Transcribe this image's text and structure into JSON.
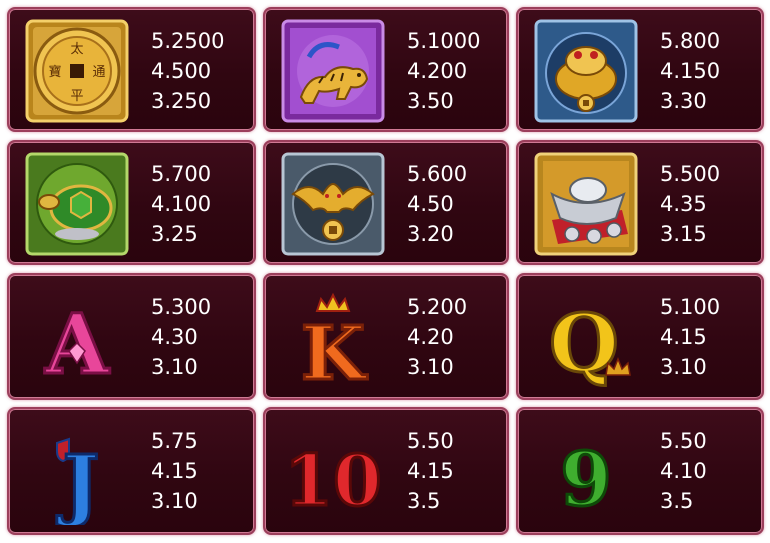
{
  "paytable": [
    {
      "symbol": "gold-coin",
      "pays": [
        "5.2500",
        "4.500",
        "3.250"
      ]
    },
    {
      "symbol": "tiger",
      "pays": [
        "5.1000",
        "4.200",
        "3.50"
      ]
    },
    {
      "symbol": "golden-toad",
      "pays": [
        "5.800",
        "4.150",
        "3.30"
      ]
    },
    {
      "symbol": "turtle",
      "pays": [
        "5.700",
        "4.100",
        "3.25"
      ]
    },
    {
      "symbol": "bat-coin",
      "pays": [
        "5.600",
        "4.50",
        "3.20"
      ]
    },
    {
      "symbol": "silver-ingot",
      "pays": [
        "5.500",
        "4.35",
        "3.15"
      ]
    },
    {
      "symbol": "letter-a",
      "pays": [
        "5.300",
        "4.30",
        "3.10"
      ]
    },
    {
      "symbol": "letter-k",
      "pays": [
        "5.200",
        "4.20",
        "3.10"
      ]
    },
    {
      "symbol": "letter-q",
      "pays": [
        "5.100",
        "4.15",
        "3.10"
      ]
    },
    {
      "symbol": "letter-j",
      "pays": [
        "5.75",
        "4.15",
        "3.10"
      ]
    },
    {
      "symbol": "number-10",
      "pays": [
        "5.50",
        "4.15",
        "3.5"
      ]
    },
    {
      "symbol": "number-9",
      "pays": [
        "5.50",
        "4.10",
        "3.5"
      ]
    }
  ],
  "symbol_text": {
    "coin_chars": [
      "太",
      "通",
      "平",
      "寶"
    ],
    "letter_a": "A",
    "letter_k": "K",
    "letter_q": "Q",
    "letter_j": "J",
    "number_10": "10",
    "number_9": "9"
  },
  "colors": {
    "card_bg": "#330711",
    "card_border": "#9c3f5c",
    "pay_text": "#ffffff",
    "gold": "#e9b53a",
    "a_pink": "#e8469a",
    "k_orange": "#f06a1e",
    "q_yellow": "#f2c41a",
    "j_blue": "#2d7fe0",
    "ten_red": "#e0282c",
    "nine_green": "#3fae2f"
  }
}
